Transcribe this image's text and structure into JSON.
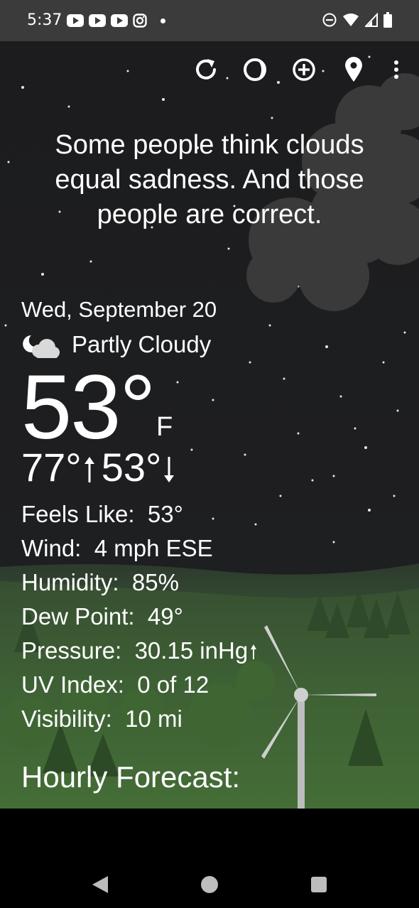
{
  "status_bar": {
    "time": "5:37",
    "left_icons": [
      "youtube-icon",
      "youtube-icon",
      "youtube-icon",
      "instagram-icon",
      "dot-icon"
    ],
    "right_icons": [
      "do-not-disturb-icon",
      "wifi-icon",
      "signal-icon",
      "battery-icon"
    ]
  },
  "toolbar": {
    "icons": [
      "refresh-icon",
      "moon-phase-icon",
      "add-location-icon",
      "location-pin-icon",
      "overflow-menu-icon"
    ]
  },
  "quote": "Some people think clouds equal sadness. And those people are correct.",
  "weather": {
    "date": "Wed, September 20",
    "condition": "Partly Cloudy",
    "condition_icon": "partly-cloudy-night-icon",
    "temperature": "53°",
    "unit": "F",
    "high": "77°",
    "low": "53°",
    "details": [
      {
        "label": "Feels Like:",
        "value": "53°"
      },
      {
        "label": "Wind:",
        "value": "4 mph ESE"
      },
      {
        "label": "Humidity:",
        "value": "85%"
      },
      {
        "label": "Dew Point:",
        "value": "49°"
      },
      {
        "label": "Pressure:",
        "value": "30.15 inHg"
      },
      {
        "label": "UV Index:",
        "value": "0 of 12"
      },
      {
        "label": "Visibility:",
        "value": "10 mi"
      }
    ]
  },
  "section": {
    "hourly_title": "Hourly Forecast:"
  },
  "nav": {
    "icons": [
      "back-icon",
      "home-icon",
      "recents-icon"
    ]
  }
}
